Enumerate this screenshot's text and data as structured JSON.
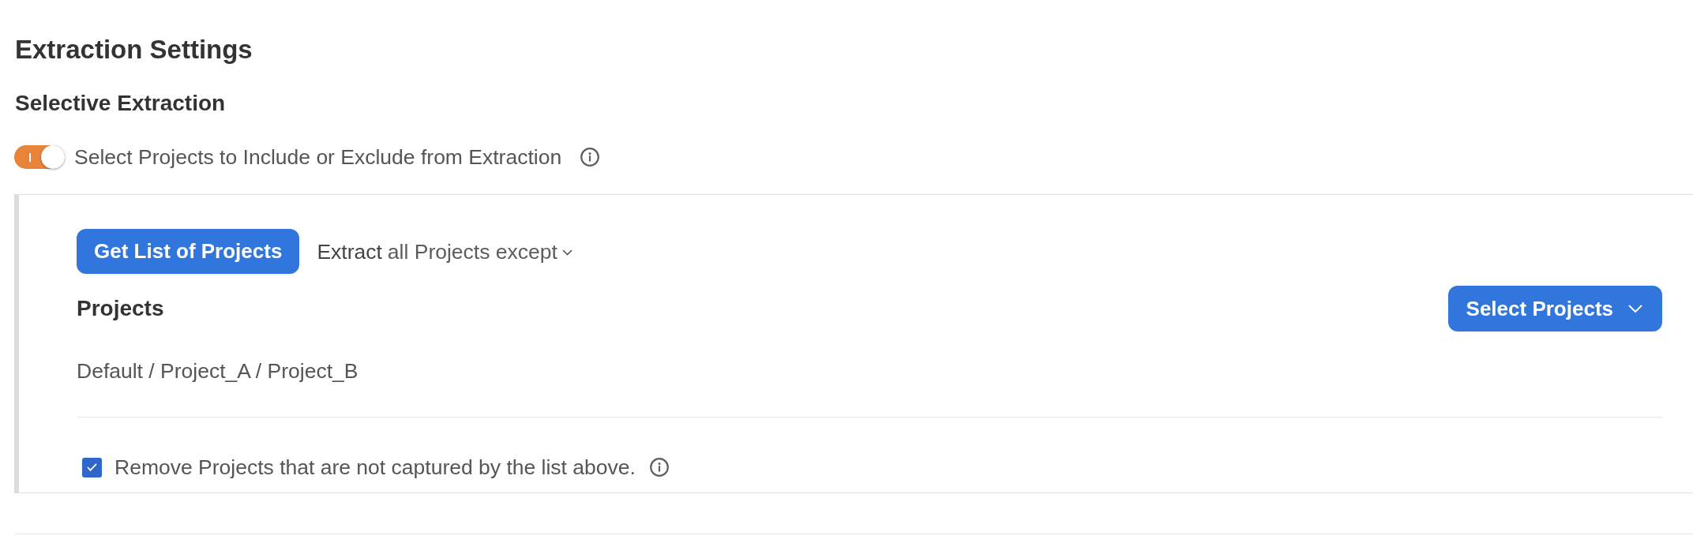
{
  "page_title": "Extraction Settings",
  "section": {
    "title": "Selective Extraction",
    "toggle": {
      "label": "Select Projects to Include or Exclude from Extraction",
      "on": true
    }
  },
  "panel": {
    "get_list_button": "Get List of Projects",
    "mode": {
      "prefix": "Extract",
      "value": "all Projects except"
    },
    "projects": {
      "title": "Projects",
      "select_button": "Select Projects",
      "value": "Default / Project_A / Project_B"
    },
    "remove_option": {
      "label": "Remove Projects that are not captured by the list above.",
      "checked": true
    }
  }
}
